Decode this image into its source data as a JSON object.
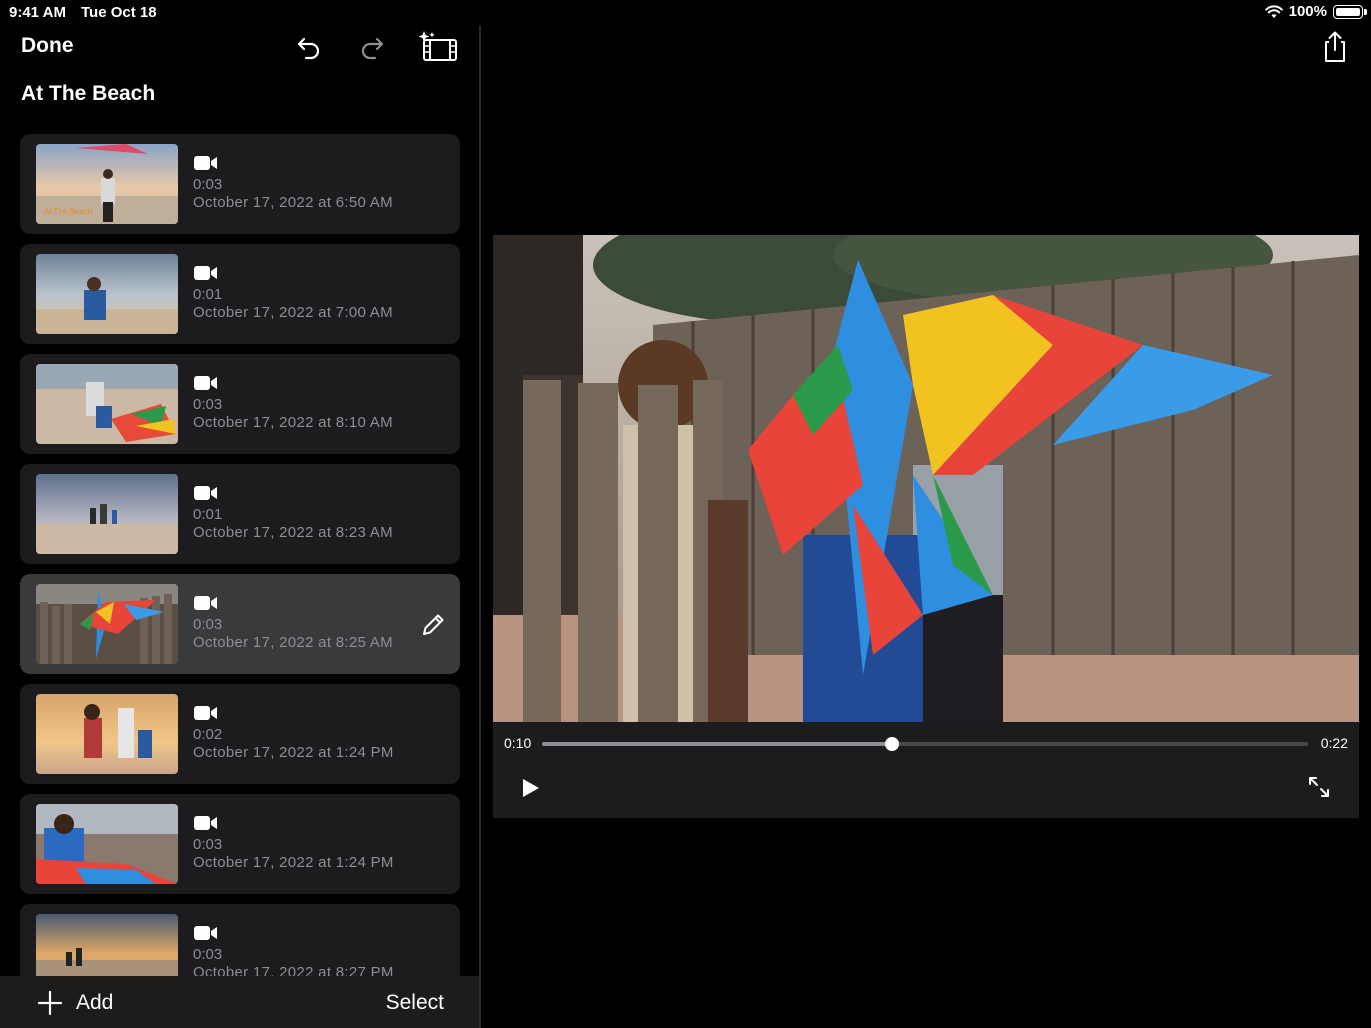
{
  "status": {
    "time": "9:41 AM",
    "date": "Tue Oct 18",
    "battery": "100%"
  },
  "toolbar": {
    "done_label": "Done"
  },
  "project": {
    "title": "At The Beach"
  },
  "clips": [
    {
      "duration": "0:03",
      "date": "October 17, 2022 at 6:50 AM",
      "overlay": "At The Beach"
    },
    {
      "duration": "0:01",
      "date": "October 17, 2022 at 7:00 AM"
    },
    {
      "duration": "0:03",
      "date": "October 17, 2022 at 8:10 AM"
    },
    {
      "duration": "0:01",
      "date": "October 17, 2022 at 8:23 AM"
    },
    {
      "duration": "0:03",
      "date": "October 17, 2022 at 8:25 AM"
    },
    {
      "duration": "0:02",
      "date": "October 17, 2022 at 1:24 PM"
    },
    {
      "duration": "0:03",
      "date": "October 17, 2022 at 1:24 PM"
    },
    {
      "duration": "0:03",
      "date": "October 17, 2022 at 8:27 PM"
    }
  ],
  "bottom": {
    "add_label": "Add",
    "select_label": "Select"
  },
  "player": {
    "current_time": "0:10",
    "total_time": "0:22",
    "progress": 0.457
  },
  "colors": {
    "card": "#1c1c1e",
    "card_selected": "#3a3a3c",
    "secondary_text": "#8e8e93"
  },
  "icons": [
    "undo-icon",
    "redo-icon",
    "magic-movie-icon",
    "video-camera-icon",
    "pencil-icon",
    "plus-icon",
    "share-icon",
    "play-icon",
    "fullscreen-icon"
  ]
}
